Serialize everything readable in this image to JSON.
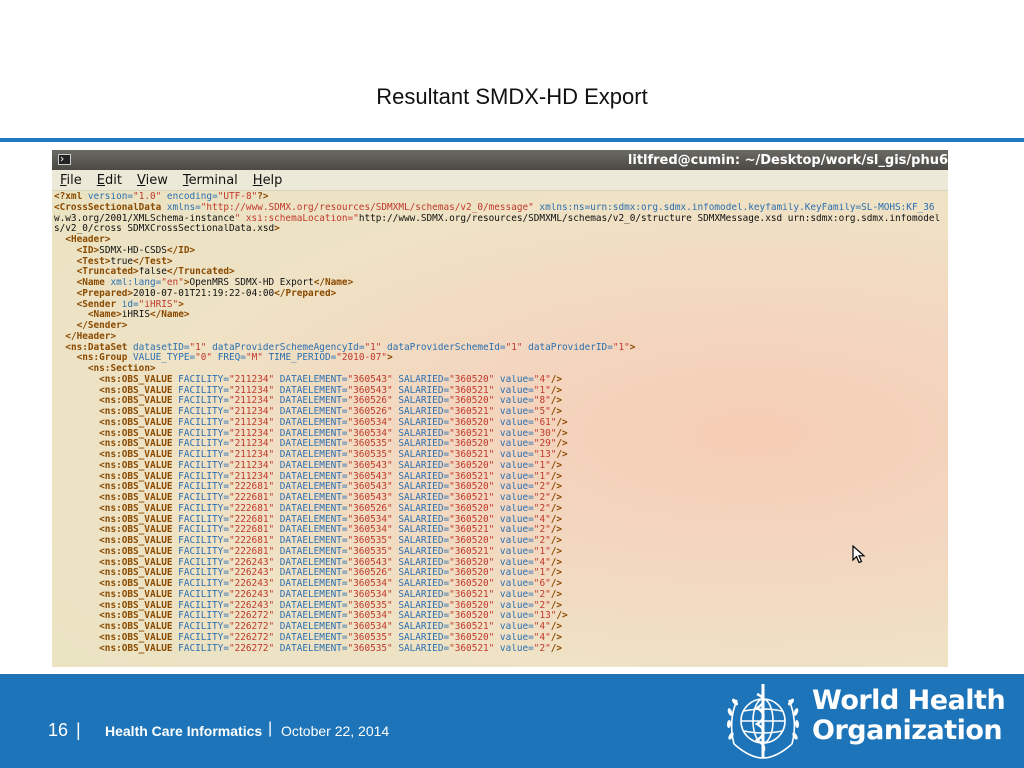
{
  "slide": {
    "title": "Resultant SMDX-HD Export"
  },
  "terminal": {
    "window_title": "litlfred@cumin: ~/Desktop/work/sl_gis/phu6",
    "menu": [
      "File",
      "Edit",
      "View",
      "Terminal",
      "Help"
    ],
    "header_lines": [
      "<?xml version=\"1.0\" encoding=\"UTF-8\"?>",
      "<CrossSectionalData xmlns=\"http://www.SDMX.org/resources/SDMXML/schemas/v2_0/message\" xmlns:ns=\"urn:sdmx:org.sdmx.infomodel.keyfamily.KeyFamily=SL-MOHS:KF_36",
      "w.w3.org/2001/XMLSchema-instance\" xsi:schemaLocation=\"http://www.SDMX.org/resources/SDMXML/schemas/v2_0/structure SDMXMessage.xsd urn:sdmx:org.sdmx.infomodel",
      "s/v2_0/cross SDMXCrossSectionalData.xsd\">",
      "  <Header>",
      "    <ID>SDMX-HD-CSDS</ID>",
      "    <Test>true</Test>",
      "    <Truncated>false</Truncated>",
      "    <Name xml:lang=\"en\">OpenMRS SDMX-HD Export</Name>",
      "    <Prepared>2010-07-01T21:19:22-04:00</Prepared>",
      "    <Sender id=\"iHRIS\">",
      "      <Name>iHRIS</Name>",
      "    </Sender>",
      "  </Header>",
      "  <ns:DataSet datasetID=\"1\" dataProviderSchemeAgencyId=\"1\" dataProviderSchemeId=\"1\" dataProviderID=\"1\">",
      "    <ns:Group VALUE_TYPE=\"0\" FREQ=\"M\" TIME_PERIOD=\"2010-07\">",
      "      <ns:Section>"
    ],
    "obs_values": [
      [
        "211234",
        "360543",
        "360520",
        "4"
      ],
      [
        "211234",
        "360543",
        "360521",
        "1"
      ],
      [
        "211234",
        "360526",
        "360520",
        "8"
      ],
      [
        "211234",
        "360526",
        "360521",
        "5"
      ],
      [
        "211234",
        "360534",
        "360520",
        "61"
      ],
      [
        "211234",
        "360534",
        "360521",
        "30"
      ],
      [
        "211234",
        "360535",
        "360520",
        "29"
      ],
      [
        "211234",
        "360535",
        "360521",
        "13"
      ],
      [
        "211234",
        "360543",
        "360520",
        "1"
      ],
      [
        "211234",
        "360543",
        "360521",
        "1"
      ],
      [
        "222681",
        "360543",
        "360520",
        "2"
      ],
      [
        "222681",
        "360543",
        "360521",
        "2"
      ],
      [
        "222681",
        "360526",
        "360520",
        "2"
      ],
      [
        "222681",
        "360534",
        "360520",
        "4"
      ],
      [
        "222681",
        "360534",
        "360521",
        "2"
      ],
      [
        "222681",
        "360535",
        "360520",
        "2"
      ],
      [
        "222681",
        "360535",
        "360521",
        "1"
      ],
      [
        "226243",
        "360543",
        "360520",
        "4"
      ],
      [
        "226243",
        "360526",
        "360520",
        "1"
      ],
      [
        "226243",
        "360534",
        "360520",
        "6"
      ],
      [
        "226243",
        "360534",
        "360521",
        "2"
      ],
      [
        "226243",
        "360535",
        "360520",
        "2"
      ],
      [
        "226272",
        "360534",
        "360520",
        "13"
      ],
      [
        "226272",
        "360534",
        "360521",
        "4"
      ],
      [
        "226272",
        "360535",
        "360520",
        "4"
      ],
      [
        "226272",
        "360535",
        "360521",
        "2"
      ]
    ]
  },
  "footer": {
    "page_number": "16",
    "separator": "|",
    "org_label": "Health Care Informatics",
    "date": "October 22, 2014",
    "who_line1": "World Health",
    "who_line2": "Organization"
  }
}
